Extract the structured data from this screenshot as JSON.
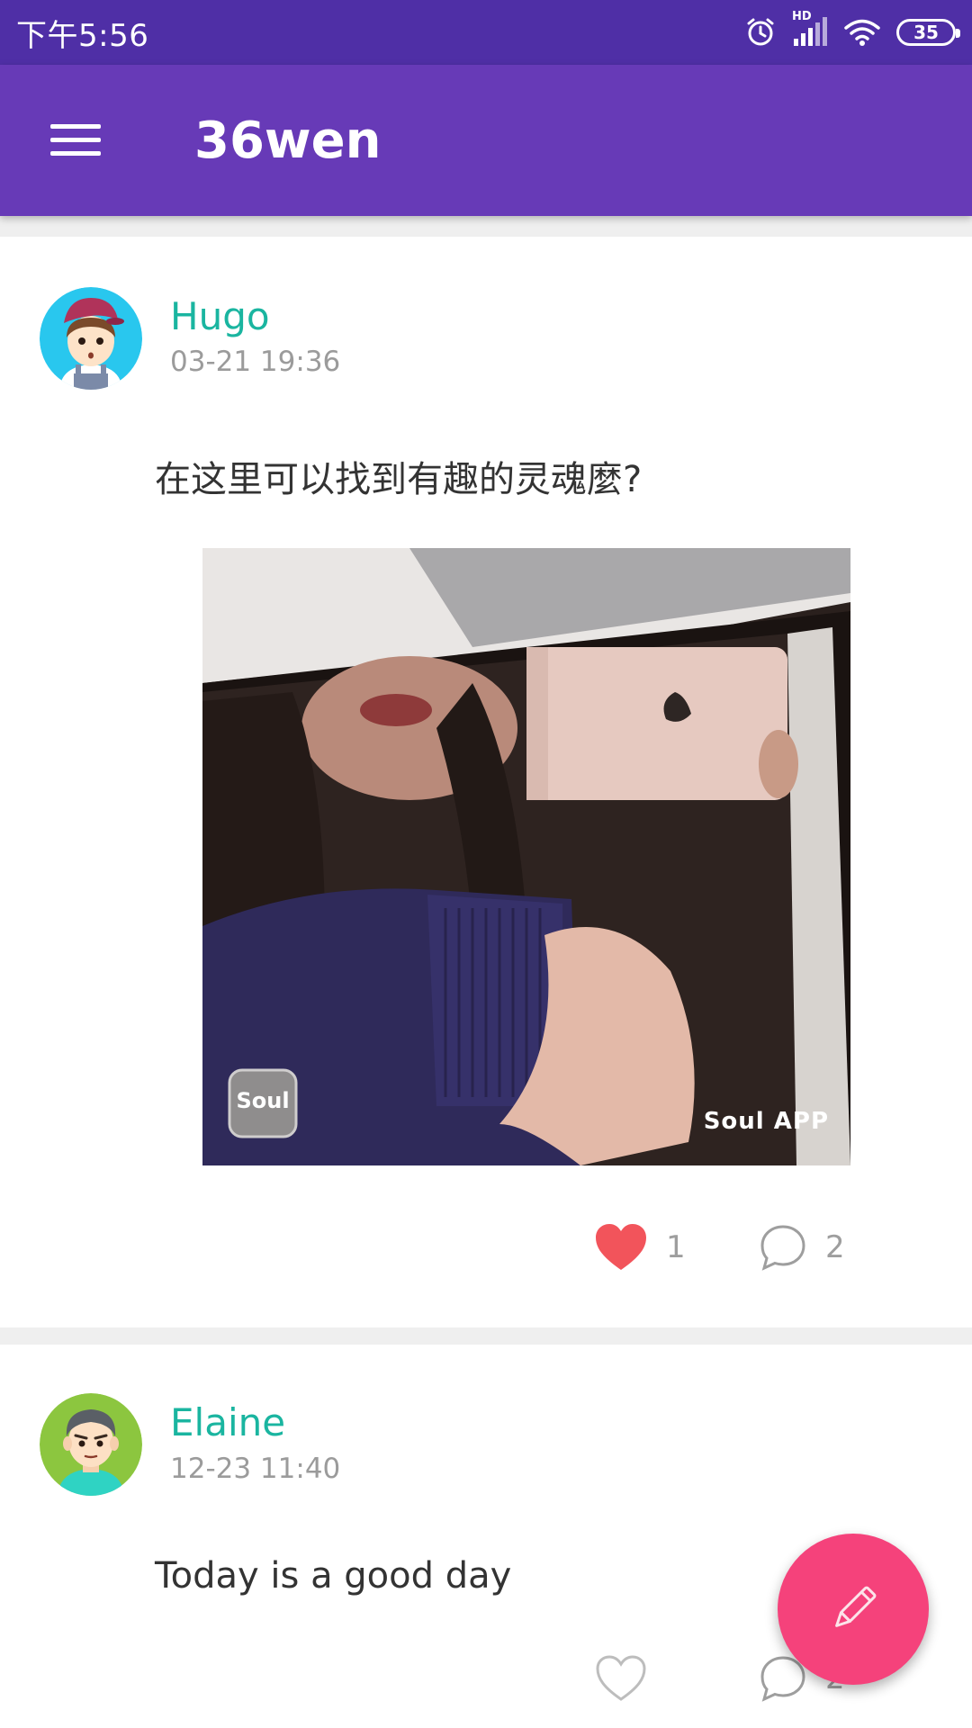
{
  "status_bar": {
    "time": "下午5:56",
    "network_label": "HD",
    "battery": "35",
    "icons": [
      "alarm-icon",
      "signal-icon",
      "wifi-icon",
      "battery-icon"
    ]
  },
  "app_bar": {
    "title": "36wen",
    "menu_icon": "menu-icon",
    "background": "#673ab7"
  },
  "posts": [
    {
      "author": "Hugo",
      "time": "03-21 19:36",
      "text": "在这里可以找到有趣的灵魂麼?",
      "image": {
        "badge_label": "Soul",
        "watermark": "Soul APP"
      },
      "likes": "1",
      "liked": true,
      "comments": "2"
    },
    {
      "author": "Elaine",
      "time": "12-23 11:40",
      "text": "Today is a good day",
      "liked": false,
      "comments": "2"
    }
  ],
  "fab": {
    "icon": "pencil-icon",
    "color": "#f5427b"
  },
  "colors": {
    "status_bar": "#4f2fa6",
    "author_name": "#1ab5a0",
    "like_active": "#f2545b"
  }
}
